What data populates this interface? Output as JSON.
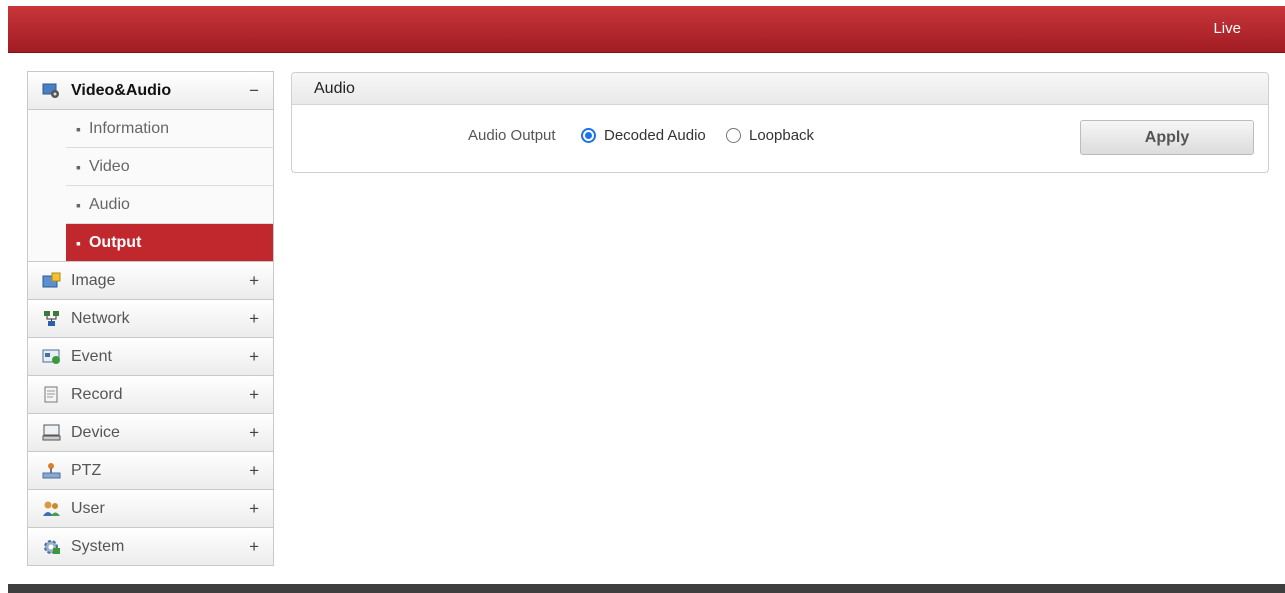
{
  "header": {
    "live_label": "Live"
  },
  "sidebar": {
    "groups": [
      {
        "label": "Video&Audio",
        "toggle": "−",
        "icon": "video-audio-icon"
      },
      {
        "label": "Image",
        "toggle": "+",
        "icon": "image-icon"
      },
      {
        "label": "Network",
        "toggle": "+",
        "icon": "network-icon"
      },
      {
        "label": "Event",
        "toggle": "+",
        "icon": "event-icon"
      },
      {
        "label": "Record",
        "toggle": "+",
        "icon": "record-icon"
      },
      {
        "label": "Device",
        "toggle": "+",
        "icon": "device-icon"
      },
      {
        "label": "PTZ",
        "toggle": "+",
        "icon": "ptz-icon"
      },
      {
        "label": "User",
        "toggle": "+",
        "icon": "user-icon"
      },
      {
        "label": "System",
        "toggle": "+",
        "icon": "system-icon"
      }
    ],
    "sub_items": [
      {
        "label": "Information"
      },
      {
        "label": "Video"
      },
      {
        "label": "Audio"
      },
      {
        "label": "Output"
      }
    ],
    "active_sub_item": "Output"
  },
  "panel": {
    "title": "Audio",
    "field_label": "Audio Output",
    "options": [
      {
        "label": "Decoded Audio",
        "selected": true
      },
      {
        "label": "Loopback",
        "selected": false
      }
    ],
    "apply_label": "Apply"
  },
  "colors": {
    "accent": "#b8242a",
    "radio_selected": "#1a73e8",
    "footer": "#3e3e3e"
  }
}
